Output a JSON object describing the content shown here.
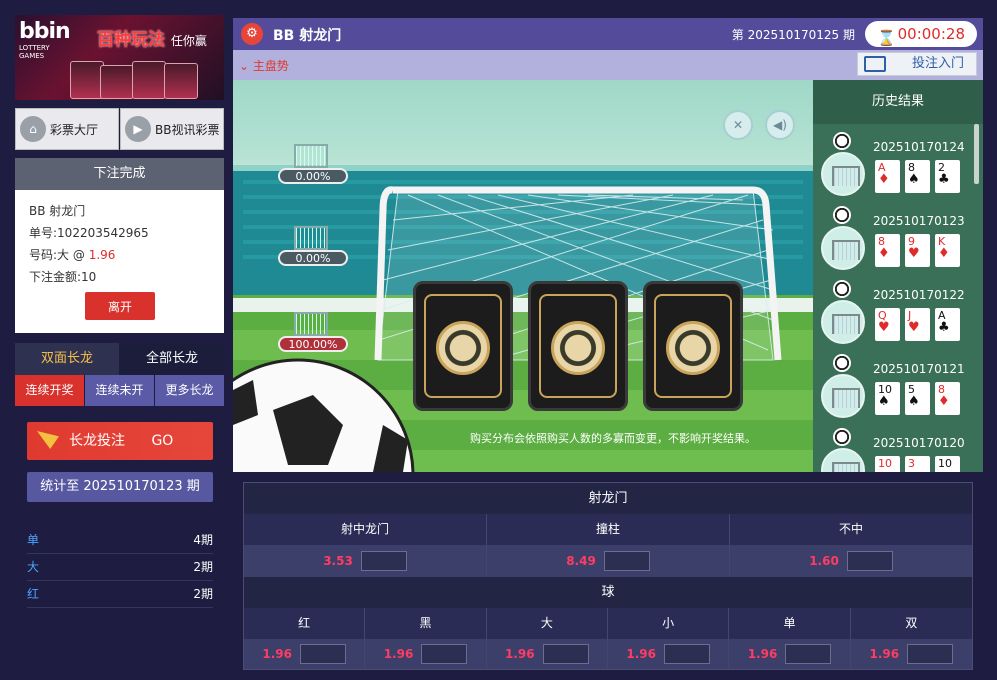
{
  "banner": {
    "logo": "bbin",
    "logo_sub": "LOTTERY GAMES",
    "headline": "百种玩法",
    "tagline": "任你赢"
  },
  "nav": {
    "lottery_hall": "彩票大厅",
    "bb_video": "BB视讯彩票"
  },
  "bet_result": {
    "title": "下注完成",
    "game": "BB 射龙门",
    "order_label": "单号:",
    "order_no": "102203542965",
    "pick_label": "号码:大 @ ",
    "pick_odds": "1.96",
    "amount_label": "下注金额:",
    "amount": "10",
    "leave_label": "离开"
  },
  "long_tabs": {
    "double": "双面长龙",
    "all": "全部长龙"
  },
  "sub_tabs": {
    "consecutive_open": "连续开奖",
    "consecutive_not_open": "连续未开",
    "more": "更多长龙"
  },
  "long_bet": {
    "label": "长龙投注",
    "go": "GO"
  },
  "stat": {
    "label": "统计至 202510170123 期",
    "rows": [
      {
        "k": "单",
        "v": "4期"
      },
      {
        "k": "大",
        "v": "2期"
      },
      {
        "k": "红",
        "v": "2期"
      }
    ]
  },
  "header": {
    "title": "BB 射龙门",
    "issue": "第 202510170125 期",
    "timer": "00:00:28"
  },
  "subbar": {
    "trend": "主盘势",
    "entry": "投注入门"
  },
  "game": {
    "percents": [
      "0.00%",
      "0.00%",
      "100.00%"
    ],
    "notice": "购买分布会依照购买人数的多寡而变更，不影响开奖结果。"
  },
  "history": {
    "title": "历史结果",
    "items": [
      {
        "issue": "202510170124",
        "cards": [
          {
            "v": "A",
            "s": "♦",
            "c": "red"
          },
          {
            "v": "8",
            "s": "♠",
            "c": "blk"
          },
          {
            "v": "2",
            "s": "♣",
            "c": "blk"
          }
        ]
      },
      {
        "issue": "202510170123",
        "cards": [
          {
            "v": "8",
            "s": "♦",
            "c": "red"
          },
          {
            "v": "9",
            "s": "♥",
            "c": "red"
          },
          {
            "v": "K",
            "s": "♦",
            "c": "red"
          }
        ]
      },
      {
        "issue": "202510170122",
        "cards": [
          {
            "v": "Q",
            "s": "♥",
            "c": "red"
          },
          {
            "v": "J",
            "s": "♥",
            "c": "red"
          },
          {
            "v": "A",
            "s": "♣",
            "c": "blk"
          }
        ]
      },
      {
        "issue": "202510170121",
        "cards": [
          {
            "v": "10",
            "s": "♠",
            "c": "blk"
          },
          {
            "v": "5",
            "s": "♠",
            "c": "blk"
          },
          {
            "v": "8",
            "s": "♦",
            "c": "red"
          }
        ]
      },
      {
        "issue": "202510170120",
        "cards": [
          {
            "v": "10",
            "s": "",
            "c": "red"
          },
          {
            "v": "3",
            "s": "",
            "c": "red"
          },
          {
            "v": "10",
            "s": "",
            "c": "blk"
          }
        ]
      }
    ]
  },
  "odds": {
    "section1": "射龙门",
    "s1_cols": [
      {
        "label": "射中龙门",
        "odds": "3.53"
      },
      {
        "label": "撞柱",
        "odds": "8.49"
      },
      {
        "label": "不中",
        "odds": "1.60"
      }
    ],
    "section2": "球",
    "s2_cols": [
      {
        "label": "红",
        "odds": "1.96"
      },
      {
        "label": "黑",
        "odds": "1.96"
      },
      {
        "label": "大",
        "odds": "1.96"
      },
      {
        "label": "小",
        "odds": "1.96"
      },
      {
        "label": "单",
        "odds": "1.96"
      },
      {
        "label": "双",
        "odds": "1.96"
      }
    ]
  }
}
